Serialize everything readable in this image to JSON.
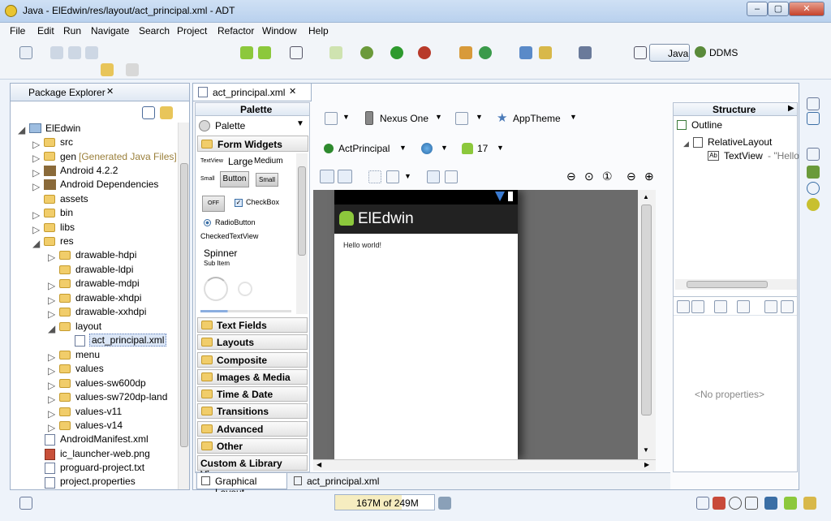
{
  "window": {
    "title": "Java - ElEdwin/res/layout/act_principal.xml - ADT",
    "min": "–",
    "max": "▢",
    "close": "✕"
  },
  "menu": [
    "File",
    "Edit",
    "Run",
    "Navigate",
    "Search",
    "Project",
    "Refactor",
    "Window",
    "Help"
  ],
  "perspectives": {
    "java": "Java",
    "ddms": "DDMS"
  },
  "package_explorer": {
    "title": "Package Explorer",
    "items": [
      {
        "label": "ElEdwin"
      },
      {
        "label": "src"
      },
      {
        "label": "gen",
        "extra": "[Generated Java Files]"
      },
      {
        "label": "Android 4.2.2"
      },
      {
        "label": "Android Dependencies"
      },
      {
        "label": "assets"
      },
      {
        "label": "bin"
      },
      {
        "label": "libs"
      },
      {
        "label": "res"
      },
      {
        "label": "drawable-hdpi"
      },
      {
        "label": "drawable-ldpi"
      },
      {
        "label": "drawable-mdpi"
      },
      {
        "label": "drawable-xhdpi"
      },
      {
        "label": "drawable-xxhdpi"
      },
      {
        "label": "layout"
      },
      {
        "label": "act_principal.xml"
      },
      {
        "label": "menu"
      },
      {
        "label": "values"
      },
      {
        "label": "values-sw600dp"
      },
      {
        "label": "values-sw720dp-land"
      },
      {
        "label": "values-v11"
      },
      {
        "label": "values-v14"
      },
      {
        "label": "AndroidManifest.xml"
      },
      {
        "label": "ic_launcher-web.png"
      },
      {
        "label": "proguard-project.txt"
      },
      {
        "label": "project.properties"
      }
    ]
  },
  "editor": {
    "tab": "act_principal.xml",
    "device": "Nexus One",
    "theme": "AppTheme",
    "activity": "ActPrincipal",
    "api": "17",
    "app_name": "ElEdwin",
    "hello": "Hello world!",
    "bottom_tabs": [
      "Graphical Layout",
      "act_principal.xml"
    ]
  },
  "palette": {
    "title": "Palette",
    "header": "Palette",
    "form_widgets": "Form Widgets",
    "tv_small_label": "TextView",
    "tv_large": "Large",
    "tv_medium": "Medium",
    "small": "Small",
    "button": "Button",
    "small_btn": "Small",
    "off": "OFF",
    "checkbox": "CheckBox",
    "radio": "RadioButton",
    "checked_tv": "CheckedTextView",
    "spinner": "Spinner",
    "sub_item": "Sub Item",
    "categories": [
      "Text Fields",
      "Layouts",
      "Composite",
      "Images & Media",
      "Time & Date",
      "Transitions",
      "Advanced",
      "Other"
    ],
    "custom": "Custom & Library Views"
  },
  "structure": {
    "title": "Structure",
    "outline": "Outline",
    "root": "RelativeLayout",
    "child": "TextView",
    "child_extra": "- \"Hello",
    "no_props": "<No properties>"
  },
  "status": {
    "memory": "167M of 249M",
    "memory_used_fraction": 0.67
  },
  "colors": {
    "accent": "#3a6ea5",
    "actionbar": "#222222",
    "android_green": "#8cc83c"
  }
}
